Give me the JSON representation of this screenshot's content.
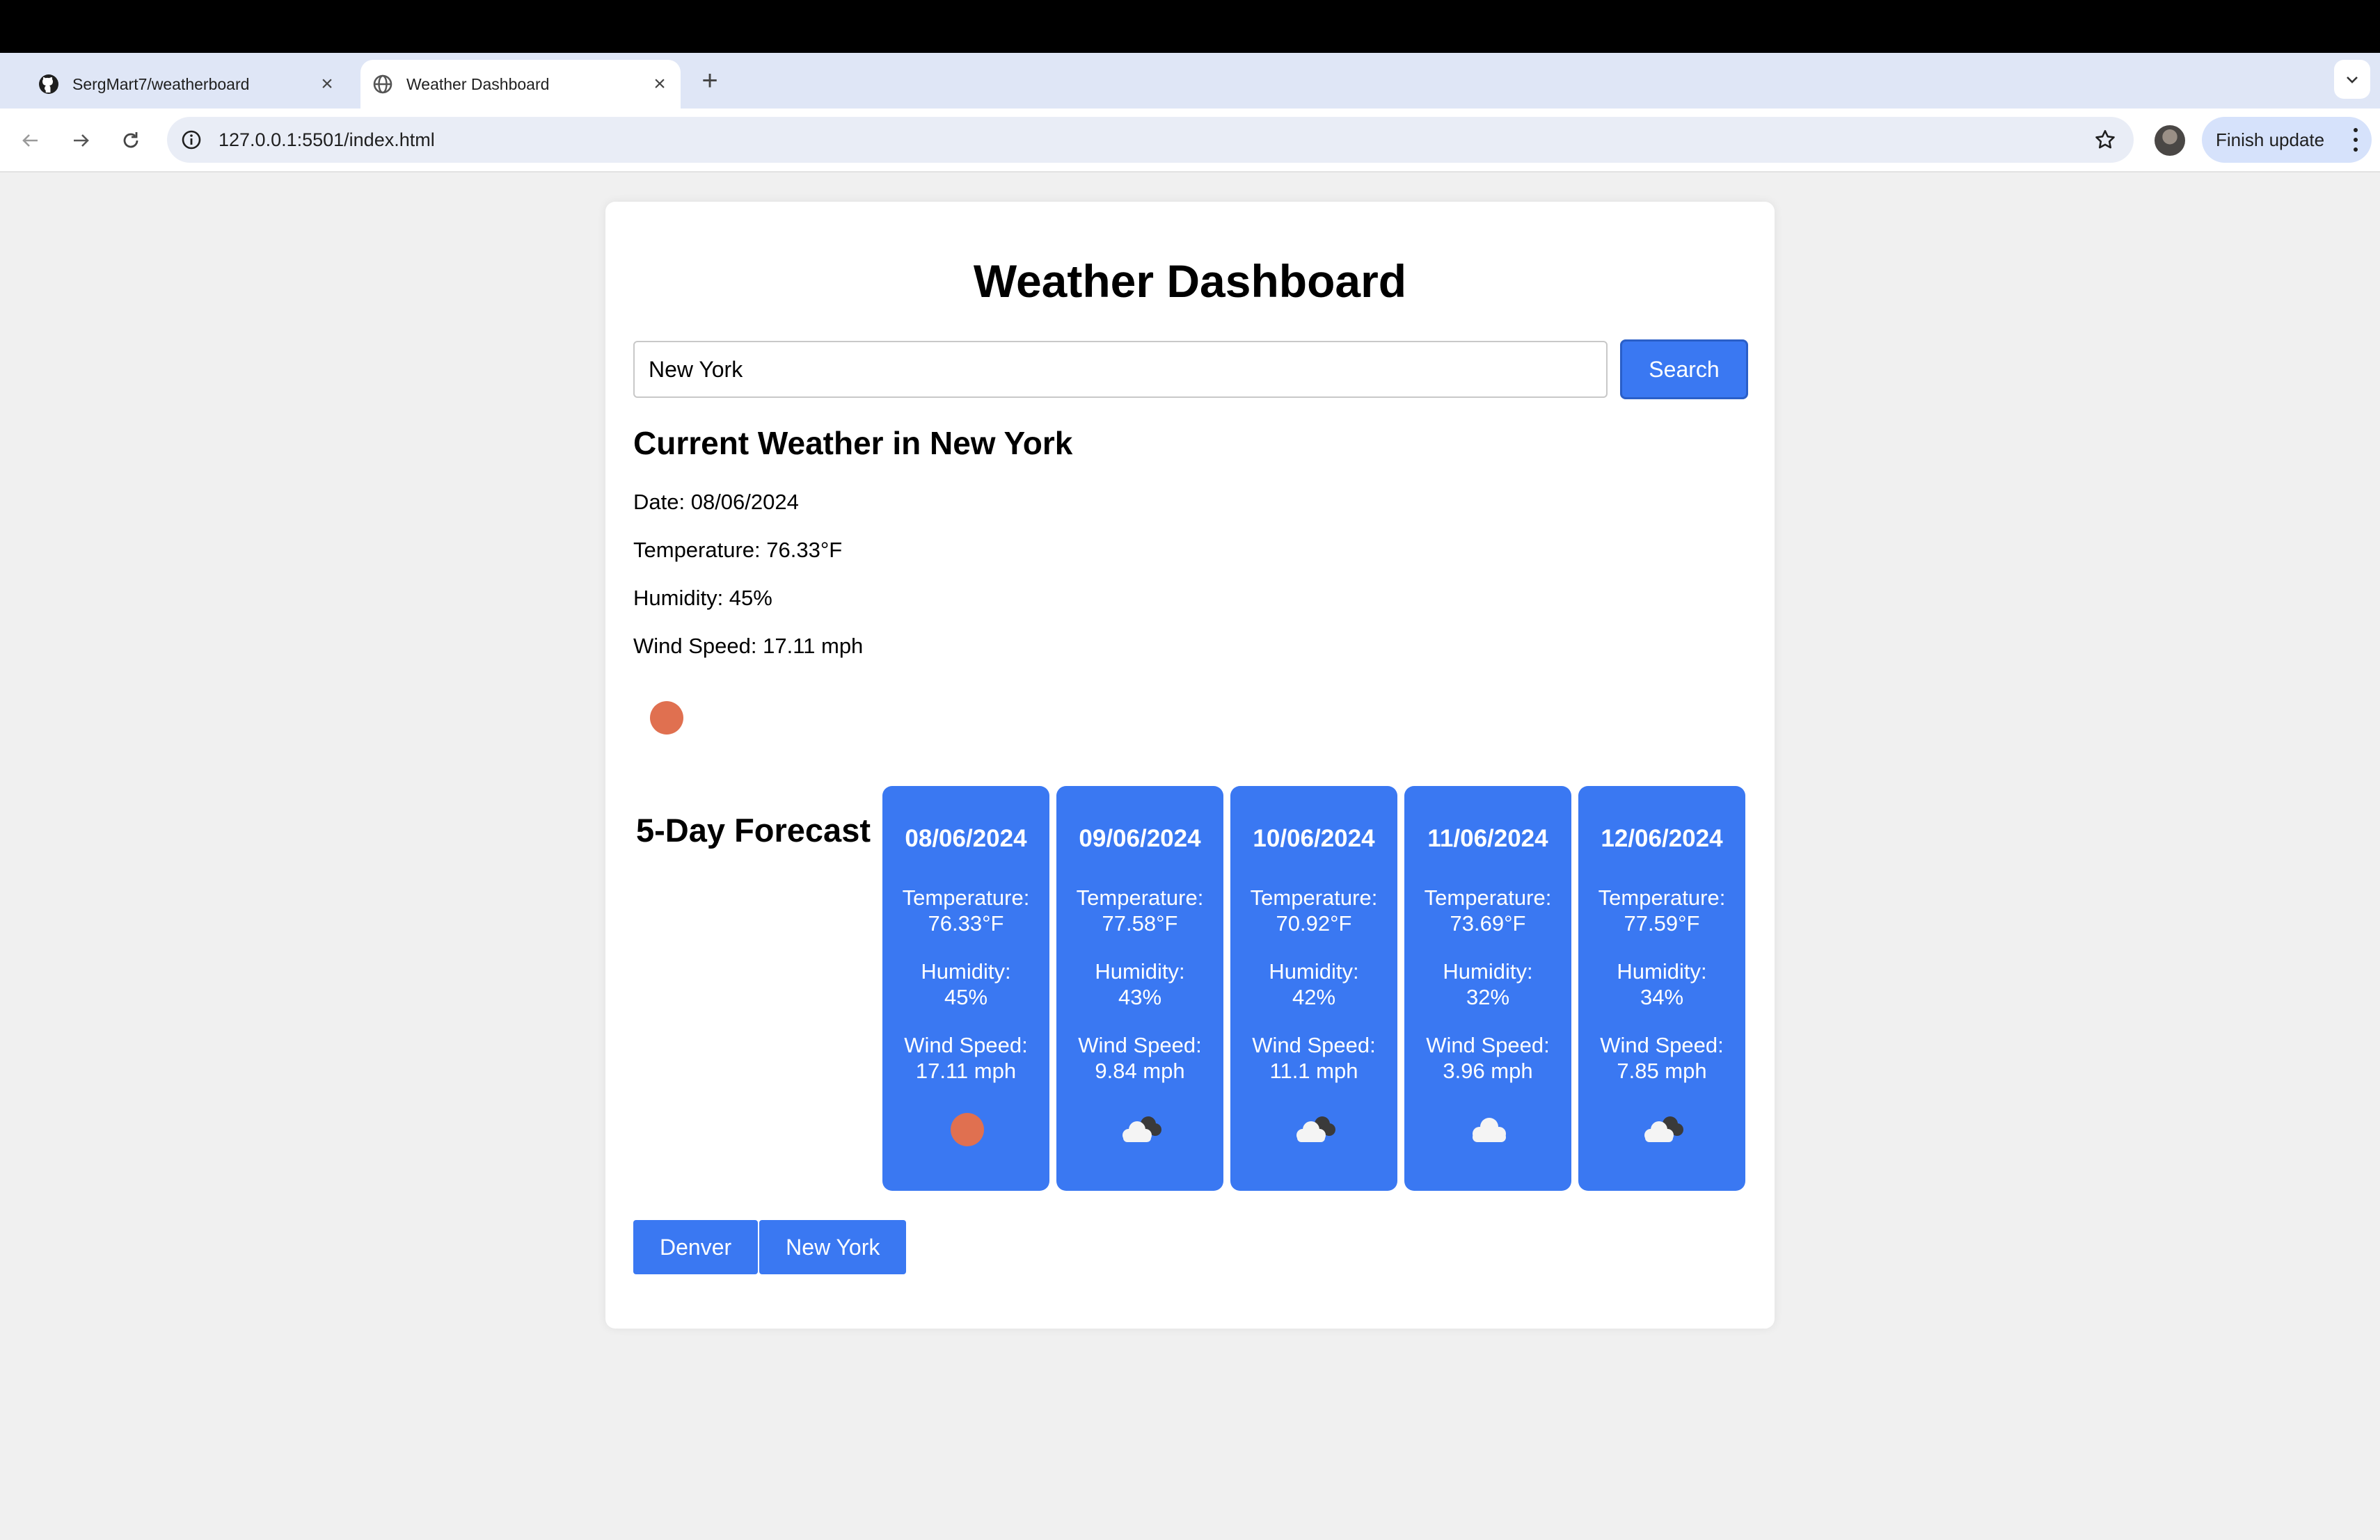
{
  "browser": {
    "tabs": [
      {
        "title": "SergMart7/weatherboard",
        "icon": "github-icon",
        "active": false
      },
      {
        "title": "Weather Dashboard",
        "icon": "globe-icon",
        "active": true
      }
    ],
    "url": "127.0.0.1:5501/index.html",
    "update_label": "Finish update"
  },
  "page": {
    "title": "Weather Dashboard",
    "search": {
      "value": "New York",
      "button_label": "Search"
    },
    "current": {
      "heading": "Current Weather in New York",
      "date": "Date: 08/06/2024",
      "temperature": "Temperature: 76.33°F",
      "humidity": "Humidity: 45%",
      "wind": "Wind Speed: 17.11 mph",
      "icon": "sun-icon"
    },
    "forecast_heading": "5-Day Forecast",
    "forecast": [
      {
        "date": "08/06/2024",
        "temp_label": "Temperature:",
        "temp": "76.33°F",
        "hum_label": "Humidity:",
        "hum": "45%",
        "wind_label": "Wind Speed:",
        "wind": "17.11 mph",
        "icon": "sun-icon"
      },
      {
        "date": "09/06/2024",
        "temp_label": "Temperature:",
        "temp": "77.58°F",
        "hum_label": "Humidity:",
        "hum": "43%",
        "wind_label": "Wind Speed:",
        "wind": "9.84 mph",
        "icon": "cloud-dark-icon"
      },
      {
        "date": "10/06/2024",
        "temp_label": "Temperature:",
        "temp": "70.92°F",
        "hum_label": "Humidity:",
        "hum": "42%",
        "wind_label": "Wind Speed:",
        "wind": "11.1 mph",
        "icon": "cloud-dark-icon"
      },
      {
        "date": "11/06/2024",
        "temp_label": "Temperature:",
        "temp": "73.69°F",
        "hum_label": "Humidity:",
        "hum": "32%",
        "wind_label": "Wind Speed:",
        "wind": "3.96 mph",
        "icon": "cloud-icon"
      },
      {
        "date": "12/06/2024",
        "temp_label": "Temperature:",
        "temp": "77.59°F",
        "hum_label": "Humidity:",
        "hum": "34%",
        "wind_label": "Wind Speed:",
        "wind": "7.85 mph",
        "icon": "cloud-dark-icon"
      }
    ],
    "history": [
      "Denver",
      "New York"
    ]
  },
  "colors": {
    "accent": "#3a78f2",
    "sun": "#e07050",
    "page_bg": "#f0f0f0"
  }
}
